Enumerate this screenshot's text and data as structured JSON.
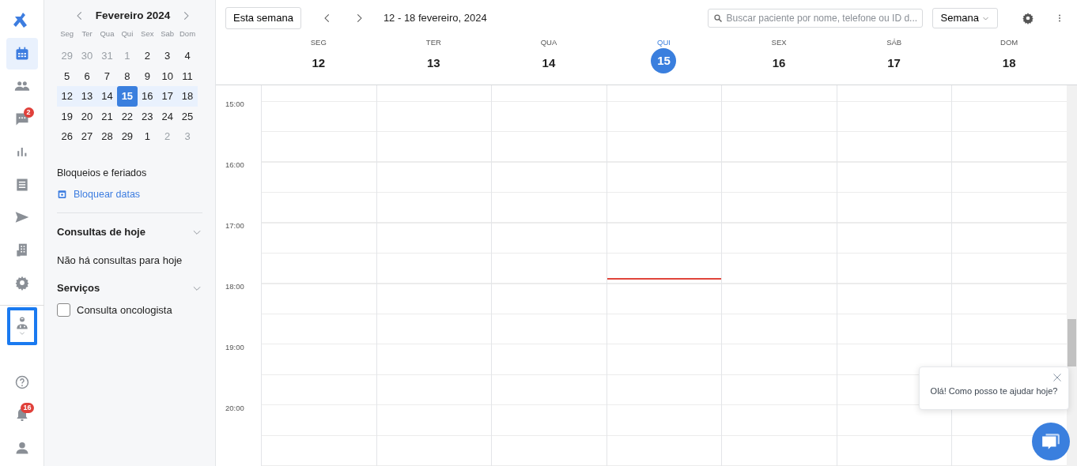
{
  "rail": {
    "top": [
      {
        "selected": false
      },
      {
        "selected": true
      },
      {
        "selected": false
      },
      {
        "selected": false,
        "badge": "2"
      },
      {
        "selected": false
      },
      {
        "selected": false
      },
      {
        "selected": false
      },
      {
        "selected": false
      },
      {
        "selected": false
      }
    ],
    "profile": {
      "selected": true
    },
    "bottom": [
      {
        "selected": false
      },
      {
        "selected": false,
        "badge": "16"
      },
      {
        "selected": false
      }
    ]
  },
  "mini_calendar": {
    "title": "Fevereiro 2024",
    "weekdays": [
      "Seg",
      "Ter",
      "Qua",
      "Qui",
      "Sex",
      "Sab",
      "Dom"
    ],
    "weeks": [
      {
        "highlighted": false,
        "days": [
          {
            "label": "29",
            "outside": true,
            "selected": false
          },
          {
            "label": "30",
            "outside": true,
            "selected": false
          },
          {
            "label": "31",
            "outside": true,
            "selected": false
          },
          {
            "label": "1",
            "outside": true,
            "selected": false
          },
          {
            "label": "2",
            "outside": false,
            "selected": false
          },
          {
            "label": "3",
            "outside": false,
            "selected": false
          },
          {
            "label": "4",
            "outside": false,
            "selected": false
          }
        ]
      },
      {
        "highlighted": false,
        "days": [
          {
            "label": "5",
            "outside": false,
            "selected": false
          },
          {
            "label": "6",
            "outside": false,
            "selected": false
          },
          {
            "label": "7",
            "outside": false,
            "selected": false
          },
          {
            "label": "8",
            "outside": false,
            "selected": false
          },
          {
            "label": "9",
            "outside": false,
            "selected": false
          },
          {
            "label": "10",
            "outside": false,
            "selected": false
          },
          {
            "label": "11",
            "outside": false,
            "selected": false
          }
        ]
      },
      {
        "highlighted": true,
        "days": [
          {
            "label": "12",
            "outside": false,
            "selected": false
          },
          {
            "label": "13",
            "outside": false,
            "selected": false
          },
          {
            "label": "14",
            "outside": false,
            "selected": false
          },
          {
            "label": "15",
            "outside": false,
            "selected": true
          },
          {
            "label": "16",
            "outside": false,
            "selected": false
          },
          {
            "label": "17",
            "outside": false,
            "selected": false
          },
          {
            "label": "18",
            "outside": false,
            "selected": false
          }
        ]
      },
      {
        "highlighted": false,
        "days": [
          {
            "label": "19",
            "outside": false,
            "selected": false
          },
          {
            "label": "20",
            "outside": false,
            "selected": false
          },
          {
            "label": "21",
            "outside": false,
            "selected": false
          },
          {
            "label": "22",
            "outside": false,
            "selected": false
          },
          {
            "label": "23",
            "outside": false,
            "selected": false
          },
          {
            "label": "24",
            "outside": false,
            "selected": false
          },
          {
            "label": "25",
            "outside": false,
            "selected": false
          }
        ]
      },
      {
        "highlighted": false,
        "days": [
          {
            "label": "26",
            "outside": false,
            "selected": false
          },
          {
            "label": "27",
            "outside": false,
            "selected": false
          },
          {
            "label": "28",
            "outside": false,
            "selected": false
          },
          {
            "label": "29",
            "outside": false,
            "selected": false
          },
          {
            "label": "1",
            "outside": false,
            "selected": false
          },
          {
            "label": "2",
            "outside": true,
            "selected": false
          },
          {
            "label": "3",
            "outside": true,
            "selected": false
          }
        ]
      }
    ]
  },
  "blocks": {
    "title": "Bloqueios e feriados",
    "link": "Bloquear datas"
  },
  "today_section": {
    "title": "Consultas de hoje",
    "expanded": true,
    "empty_text": "Não há consultas para hoje"
  },
  "services_section": {
    "title": "Serviços",
    "expanded": true,
    "items": [
      {
        "label": "Consulta oncologista",
        "checked": false
      }
    ]
  },
  "toolbar": {
    "today_button": "Esta semana",
    "range": "12 - 18 fevereiro, 2024",
    "search": {
      "placeholder": "Buscar paciente por nome, telefone ou ID d..."
    },
    "view": "Semana"
  },
  "days": [
    {
      "weekday": "SEG",
      "date": "12",
      "today": false
    },
    {
      "weekday": "TER",
      "date": "13",
      "today": false
    },
    {
      "weekday": "QUA",
      "date": "14",
      "today": false
    },
    {
      "weekday": "QUI",
      "date": "15",
      "today": true
    },
    {
      "weekday": "SEX",
      "date": "16",
      "today": false
    },
    {
      "weekday": "SÁB",
      "date": "17",
      "today": false
    },
    {
      "weekday": "DOM",
      "date": "18",
      "today": false
    }
  ],
  "hours": [
    "15:00",
    "16:00",
    "17:00",
    "18:00",
    "19:00",
    "20:00"
  ],
  "chat": {
    "message": "Olá! Como posso te ajudar hoje?"
  }
}
